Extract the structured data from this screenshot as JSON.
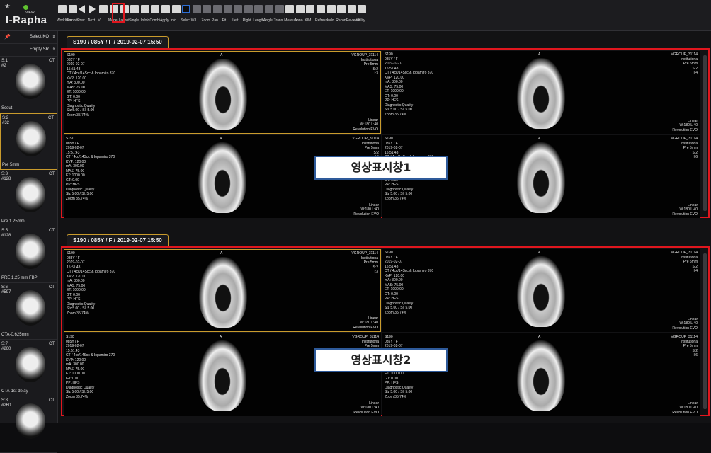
{
  "app": {
    "logo_view": "VIEW",
    "logo_name": "I-Rapha"
  },
  "toolbar": {
    "tools": [
      {
        "label": "WorkItem"
      },
      {
        "label": "Report"
      },
      {
        "label": "Prev"
      },
      {
        "label": "Next"
      },
      {
        "label": "VL"
      },
      {
        "label": "Mode"
      },
      {
        "label": "Layout"
      },
      {
        "label": "Single"
      },
      {
        "label": "Unfold"
      },
      {
        "label": "Combi"
      },
      {
        "label": "Apply"
      },
      {
        "label": "Info"
      },
      {
        "label": "Select"
      },
      {
        "label": "W/L"
      },
      {
        "label": "Zoom"
      },
      {
        "label": "Pan"
      },
      {
        "label": "Fit"
      },
      {
        "label": "Left"
      },
      {
        "label": "Right"
      },
      {
        "label": "Length"
      },
      {
        "label": "Angle"
      },
      {
        "label": "Trans"
      },
      {
        "label": "Measure"
      },
      {
        "label": "Anno"
      },
      {
        "label": "KIM"
      },
      {
        "label": "Refresh"
      },
      {
        "label": "Undo"
      },
      {
        "label": "Recon"
      },
      {
        "label": "Reviews"
      },
      {
        "label": "Utility"
      }
    ]
  },
  "sidebar": {
    "select_ko": "Select KO",
    "empty_sr": "Empty SR",
    "thumbs": [
      {
        "series": "S:1",
        "num": "#2",
        "ct": "CT",
        "cap": "Scout"
      },
      {
        "series": "S:2",
        "num": "#32",
        "ct": "CT",
        "cap": "Pre 5mm"
      },
      {
        "series": "S:3",
        "num": "#128",
        "ct": "CT",
        "cap": "Pre 1.25mm"
      },
      {
        "series": "S:5",
        "num": "#128",
        "ct": "CT",
        "cap": "PRE 1.25 mm FBP"
      },
      {
        "series": "S:6",
        "num": "#597",
        "ct": "CT",
        "cap": "CTA-0.625mm"
      },
      {
        "series": "S:7",
        "num": "#260",
        "ct": "CT",
        "cap": "CTA-1st delay"
      },
      {
        "series": "S:8",
        "num": "#260",
        "ct": "CT",
        "cap": ""
      }
    ]
  },
  "windows": [
    {
      "title": "S190 / 085Y / F / 2019-02-07 15:50",
      "label": "영상표시창1"
    },
    {
      "title": "S190 / 085Y / F / 2019-02-07 15:50",
      "label": "영상표시창2"
    }
  ],
  "cells": [
    {
      "tl": "S190\n085Y / F\n2019-02-07\n15:51:43\nCT / 4cc/14Scc & Iopamiro 370\nKVP: 120.00\nmA: 300.00\nMAS: 75.00\nET: 1000.00\nGT: 0.00\nPP: HFS\nDiagnostic Quality\nSlz 5.00 / Sl: 5.00\nZoom 35.74%",
      "tc": "A",
      "tr": "VGROUP_31114\nInstitutiona\nPre 5mm\nS:2\nI:3",
      "br": "Linear\nW:180 L:40\nRevolution EVO"
    },
    {
      "tl": "S190\n085Y / F\n2019-02-07\n15:51:43\nCT / 4cc/14Scc & Iopamiro 370\nKVP: 120.00\nmA: 300.00\nMAS: 75.00\nET: 1000.00\nGT: 0.00\nPP: HFS\nDiagnostic Quality\nSlz 5.00 / Sl: 5.00\nZoom 35.74%",
      "tc": "A",
      "tr": "VGROUP_31114\nInstitutiona\nPre 5mm\nS:2\nI:4",
      "br": "Linear\nW:180 L:40\nRevolution EVO"
    },
    {
      "tl": "S190\n085Y / F\n2019-02-07\n15:51:43\nCT / 4cc/14Scc & Iopamiro 370\nKVP: 120.00\nmA: 300.00\nMAS: 75.00\nET: 1000.00\nGT: 0.00\nPP: HFS\nDiagnostic Quality\nSlz 5.00 / Sl: 5.00\nZoom 35.74%",
      "tc": "A",
      "tr": "VGROUP_31114\nInstitutiona\nPre 5mm\nS:2\nI:5",
      "br": "Linear\nW:180 L:40\nRevolution EVO"
    },
    {
      "tl": "S190\n085Y / F\n2019-02-07\n15:51:43\nCT / 4cc/14Scc & Iopamiro 370\nKVP: 120.00\nmA: 300.00\nMAS: 75.00\nET: 1000.00\nGT: 0.00\nPP: HFS\nDiagnostic Quality\nSlz 5.00 / Sl: 5.00\nZoom 35.74%",
      "tc": "A",
      "tr": "VGROUP_31114\nInstitutiona\nPre 5mm\nS:2\nI:6",
      "br": "Linear\nW:180 L:40\nRevolution EVO"
    }
  ],
  "colors": {
    "highlight": "#e0161e",
    "selection": "#c99b2c",
    "accent": "#2e6fd6"
  }
}
